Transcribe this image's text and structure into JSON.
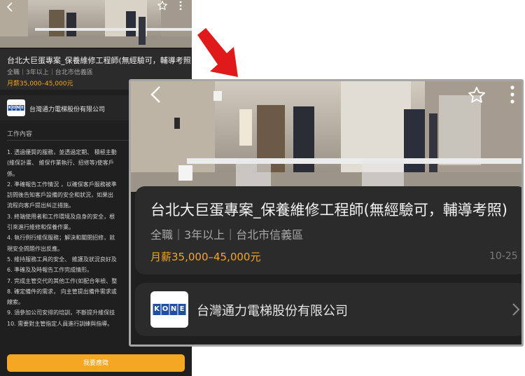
{
  "job": {
    "title": "台北大巨蛋專案_保養維修工程師(無經驗可，輔導考照)",
    "meta": "全職｜3年以上｜台北市信義區",
    "salary": "月薪35,000–45,000元",
    "date": "10-25"
  },
  "company": {
    "name": "台灣通力電梯股份有限公司",
    "logo_letters": [
      "K",
      "O",
      "N",
      "E"
    ],
    "brand_color": "#1f4ea3"
  },
  "description": {
    "section_title": "工作內容",
    "lines": "1. 透過優質的服務，並透過定期、 積極主動\n(維保計畫、 維保作業執行、招修等)使客戶\n係。\n2. 準確報告工作情況 ，以確保客戶服務被準\n訪問後告知客戶設備的安全和狀況，如果出\n流程向客戶提出糾正措施。\n3. 終端使用者和工作環境及自身的安全，根\n引來進行維修和保養作業。\n4. 執行例行維保服務；解決和關閉招修，就\n現安全問題作出反應。\n5. 維持服務工具的安全、 維護及狀況良好及\n6. 準確及及時報告工作完成情形。\n7. 完成主管交代的其他工作(如配合年檢、整\n8. 確定備件的需求， 向主管提出備件需求或\n線索。\n9. 須參加公司安排的培訓，不斷提升維保技\n10. 需要對主管指定人員進行訓練與指導。"
  },
  "actions": {
    "apply_label": "我要應徵"
  },
  "icons": {
    "back": "chevron-left-icon",
    "favorite": "star-outline-icon",
    "more": "more-vertical-icon",
    "open_company": "chevron-right-icon",
    "pointer": "red-arrow-icon"
  },
  "colors": {
    "accent": "#f5a623",
    "background": "#1f1f1f",
    "card": "#2b2b2b",
    "arrow": "#e01a1a"
  }
}
